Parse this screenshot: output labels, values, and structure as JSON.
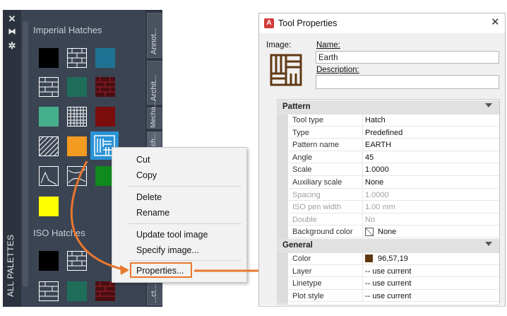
{
  "palette": {
    "title": "ALL PALETTES",
    "controls": [
      "✕",
      "⧓",
      "✲"
    ],
    "groups": [
      "Imperial Hatches",
      "ISO Hatches"
    ],
    "tabs": [
      "Annot...",
      "Archit...",
      "Mecha...",
      "...ch...",
      "...ct..."
    ],
    "swatch_colors": {
      "black": "#000000",
      "teal": "#1e7394",
      "dark_green": "#1f6e5a",
      "seafoam": "#46b08c",
      "maroon": "#7b0d0d",
      "orange": "#f39a21",
      "green": "#0e8a1e",
      "yellow": "#ffff00",
      "selected": "#2a93d6"
    }
  },
  "context_menu": {
    "items": [
      "Cut",
      "Copy",
      "Delete",
      "Rename",
      "Update tool image",
      "Specify image...",
      "Properties..."
    ]
  },
  "dialog": {
    "title": "Tool Properties",
    "logo": "A",
    "close": "✕",
    "image_label": "Image:",
    "name_label": "Name:",
    "name_value": "Earth",
    "description_label": "Description:",
    "description_value": "",
    "pattern": {
      "header": "Pattern",
      "rows": [
        {
          "k": "Tool type",
          "v": "Hatch"
        },
        {
          "k": "Type",
          "v": "Predefined"
        },
        {
          "k": "Pattern name",
          "v": "EARTH"
        },
        {
          "k": "Angle",
          "v": "45"
        },
        {
          "k": "Scale",
          "v": "1.0000"
        },
        {
          "k": "Auxiliary scale",
          "v": "None"
        },
        {
          "k": "Spacing",
          "v": "1.0000",
          "disabled": true
        },
        {
          "k": "ISO pen width",
          "v": "1.00 mm",
          "disabled": true
        },
        {
          "k": "Double",
          "v": "No",
          "disabled": true
        },
        {
          "k": "Background color",
          "v": "None"
        }
      ]
    },
    "general": {
      "header": "General",
      "rows": [
        {
          "k": "Color",
          "v": "96,57,19"
        },
        {
          "k": "Layer",
          "v": "-- use current"
        },
        {
          "k": "Linetype",
          "v": "-- use current"
        },
        {
          "k": "Plot style",
          "v": "-- use current"
        }
      ]
    },
    "earth_color": "#603913",
    "accent": "#e8772e"
  }
}
